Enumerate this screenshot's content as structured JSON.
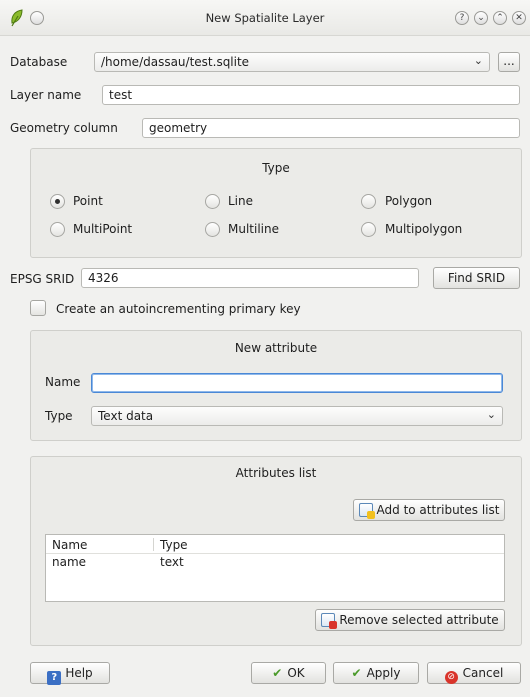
{
  "window": {
    "title": "New Spatialite Layer",
    "controls": [
      "?",
      "⌄",
      "⌃",
      "✕"
    ]
  },
  "database": {
    "label": "Database",
    "value": "/home/dassau/test.sqlite",
    "browse_label": "..."
  },
  "layer_name": {
    "label": "Layer name",
    "value": "test"
  },
  "geometry_column": {
    "label": "Geometry column",
    "value": "geometry"
  },
  "type_group": {
    "title": "Type",
    "options": [
      "Point",
      "Line",
      "Polygon",
      "MultiPoint",
      "Multiline",
      "Multipolygon"
    ],
    "selected": "Point"
  },
  "epsg": {
    "label": "EPSG SRID",
    "value": "4326",
    "find_button": "Find SRID"
  },
  "primary_key": {
    "label": "Create an autoincrementing primary key",
    "checked": false
  },
  "new_attribute": {
    "title": "New attribute",
    "name_label": "Name",
    "name_value": "",
    "type_label": "Type",
    "type_value": "Text data"
  },
  "attributes_list": {
    "title": "Attributes list",
    "add_button": "Add to attributes list",
    "columns": [
      "Name",
      "Type"
    ],
    "rows": [
      {
        "name": "name",
        "type": "text"
      }
    ],
    "remove_button": "Remove selected attribute"
  },
  "footer": {
    "help": "Help",
    "ok": "OK",
    "apply": "Apply",
    "cancel": "Cancel"
  },
  "colors": {
    "accent": "#4a88d6",
    "background": "#f1f1ef",
    "group": "#ebebe8",
    "cancel_red": "#d9342b",
    "ok_green": "#4a9a2a"
  }
}
